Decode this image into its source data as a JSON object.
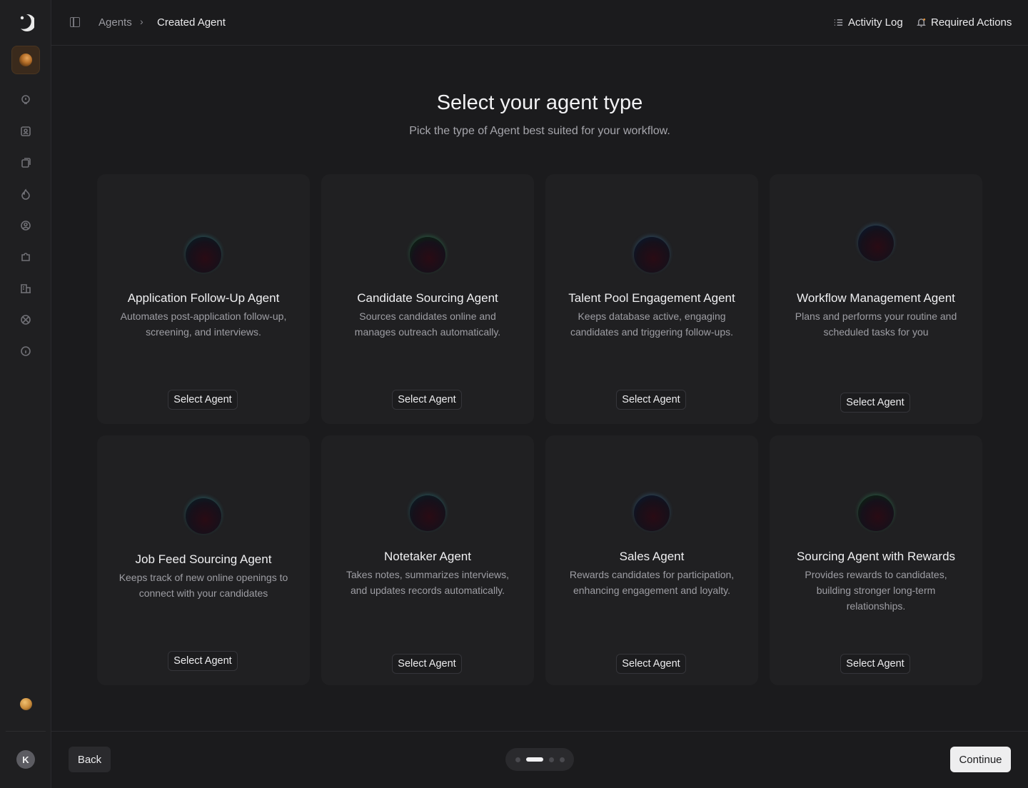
{
  "breadcrumb": {
    "root": "Agents",
    "separator": "›",
    "current": "Created Agent"
  },
  "header_actions": {
    "activity_log": "Activity Log",
    "required_actions": "Required Actions"
  },
  "page": {
    "title": "Select your agent type",
    "subtitle": "Pick the type of Agent best suited for your workflow."
  },
  "agents": [
    {
      "name": "Application Follow-Up Agent",
      "description": "Automates post-application follow-up, screening, and interviews.",
      "button": "Select Agent",
      "orb_color": "#38c7d8"
    },
    {
      "name": "Candidate Sourcing Agent",
      "description": "Sources candidates online and manages outreach automatically.",
      "button": "Select Agent",
      "orb_color": "#3fe08a"
    },
    {
      "name": "Talent Pool Engagement Agent",
      "description": "Keeps database active, engaging candidates and triggering follow-ups.",
      "button": "Select Agent",
      "orb_color": "#4aa2e8"
    },
    {
      "name": "Workflow Management Agent",
      "description": "Plans and performs your routine and scheduled tasks for you",
      "button": "Select Agent",
      "orb_color": "#4aa2e8"
    },
    {
      "name": "Job Feed Sourcing Agent",
      "description": "Keeps track of new online openings to connect with your candidates",
      "button": "Select Agent",
      "orb_color": "#38c7d8"
    },
    {
      "name": "Notetaker Agent",
      "description": "Takes notes, summarizes interviews, and updates records automatically.",
      "button": "Select Agent",
      "orb_color": "#38c7d8"
    },
    {
      "name": "Sales Agent",
      "description": "Rewards candidates for participation, enhancing engagement and loyalty.",
      "button": "Select Agent",
      "orb_color": "#4aa2e8"
    },
    {
      "name": "Sourcing Agent with Rewards",
      "description": "Provides rewards to candidates, building stronger long-term relationships.",
      "button": "Select Agent",
      "orb_color": "#3fe08a"
    }
  ],
  "footer": {
    "back": "Back",
    "continue": "Continue",
    "pager": {
      "total": 4,
      "active": 2
    }
  },
  "user": {
    "avatar_initial": "K"
  },
  "sidebar": {
    "icons": [
      "bulb-icon",
      "contacts-icon",
      "documents-icon",
      "flame-icon",
      "user-circle-icon",
      "puzzle-icon",
      "building-icon",
      "basketball-icon",
      "info-icon"
    ]
  }
}
